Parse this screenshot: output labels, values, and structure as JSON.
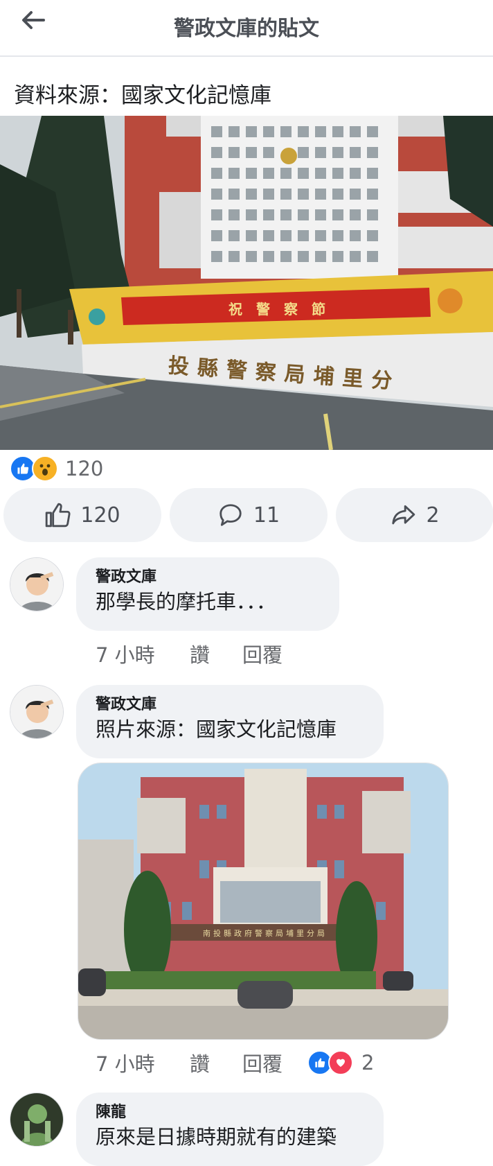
{
  "header": {
    "title": "警政文庫的貼文"
  },
  "post": {
    "text": "資料來源：國家文化記憶庫",
    "photo": {
      "banner_text": "祝　警　察　節",
      "wall_sign": "投縣警察局埔里分"
    },
    "reactions": {
      "icons": [
        "like-reaction-icon",
        "wow-reaction-icon"
      ],
      "count": "120"
    },
    "actions": {
      "like_count": "120",
      "comment_count": "11",
      "share_count": "2"
    }
  },
  "comments": [
    {
      "author": "警政文庫",
      "text": "那學長的摩托車．．．",
      "time": "7 小時",
      "like": "讚",
      "reply": "回覆"
    },
    {
      "author": "警政文庫",
      "text": "照片來源：國家文化記憶庫",
      "time": "7 小時",
      "like": "讚",
      "reply": "回覆",
      "photo": {
        "sign_text": "南投縣政府警察局埔里分局"
      },
      "reactions": {
        "icons": [
          "like-reaction-icon",
          "love-reaction-icon"
        ],
        "count": "2"
      }
    },
    {
      "author": "陳龍",
      "text": "原來是日據時期就有的建築"
    }
  ],
  "colors": {
    "like_blue": "#1877f2",
    "wow_yellow": "#f7b125",
    "love_red": "#f33e58",
    "bubble_grey": "#f0f2f5"
  }
}
